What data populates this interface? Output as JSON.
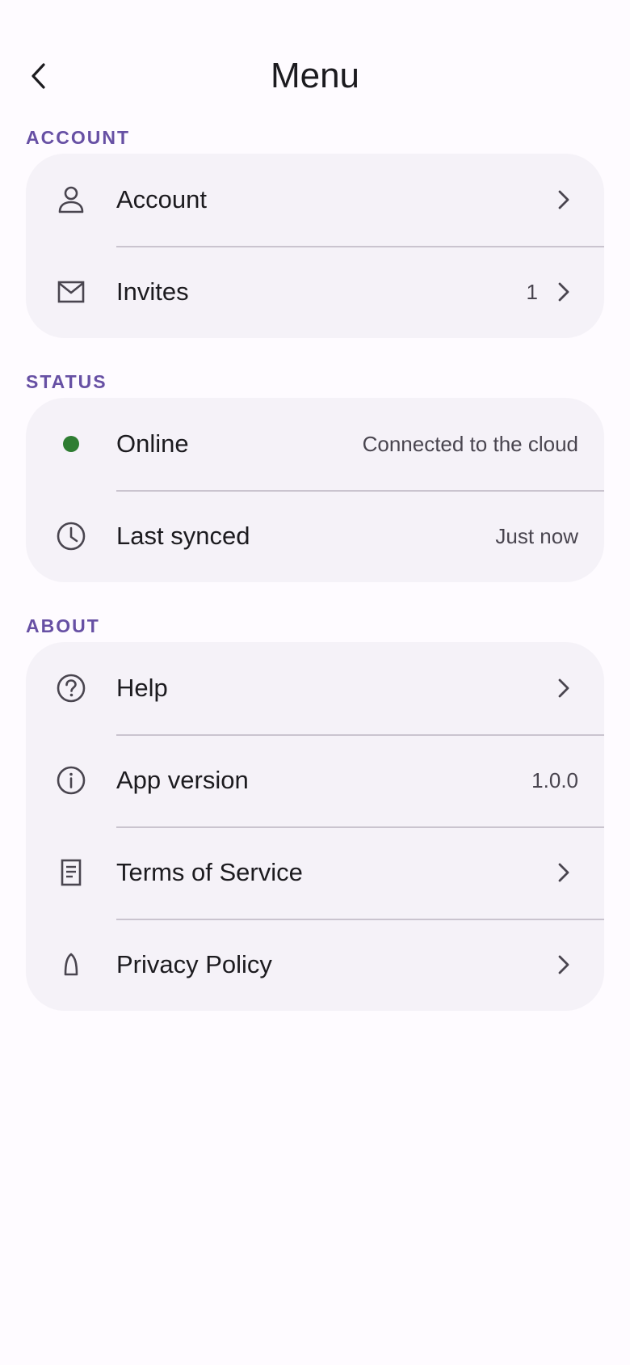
{
  "header": {
    "title": "Menu",
    "back_icon": "chevron-left-icon"
  },
  "colors": {
    "section_header": "#6750a4",
    "card_background": "#f5f2f8",
    "online_dot": "#2e7d32",
    "divider": "#cac4cf"
  },
  "sections": {
    "account": {
      "title": "ACCOUNT",
      "items": [
        {
          "label": "Account",
          "icon": "person-icon"
        },
        {
          "label": "Invites",
          "icon": "mail-icon",
          "value": "1"
        }
      ]
    },
    "status": {
      "title": "STATUS",
      "items": [
        {
          "label": "Online",
          "icon": "status-dot-icon",
          "value": "Connected to the cloud"
        },
        {
          "label": "Last synced",
          "icon": "clock-icon",
          "value": "Just now"
        }
      ]
    },
    "about": {
      "title": "ABOUT",
      "items": [
        {
          "label": "Help",
          "icon": "help-circle-icon"
        },
        {
          "label": "App version",
          "icon": "info-circle-icon",
          "value": "1.0.0"
        },
        {
          "label": "Terms of Service",
          "icon": "document-icon"
        },
        {
          "label": "Privacy Policy",
          "icon": "privacy-icon"
        }
      ]
    }
  }
}
